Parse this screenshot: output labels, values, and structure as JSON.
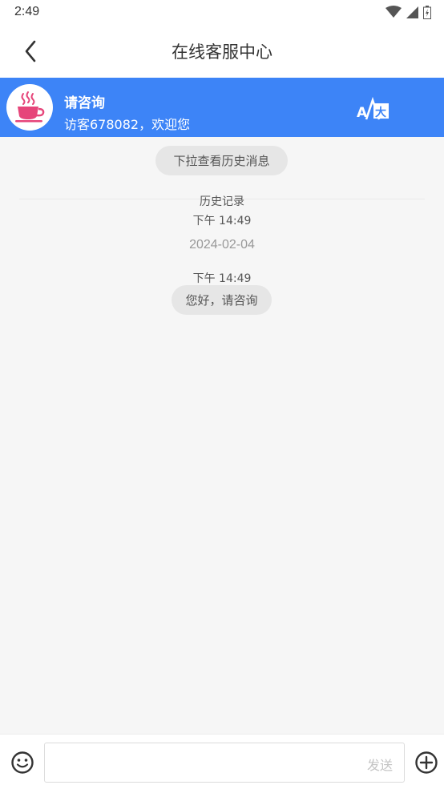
{
  "status_bar": {
    "time": "2:49"
  },
  "header": {
    "title": "在线客服中心"
  },
  "agent": {
    "name": "请咨询",
    "greeting": "访客678082，欢迎您"
  },
  "chat": {
    "history_button": "下拉查看历史消息",
    "history_label": "历史记录",
    "time_1": "下午 14:49",
    "date": "2024-02-04",
    "time_2": "下午 14:49",
    "message": "您好，请咨询"
  },
  "input": {
    "send_label": "发送",
    "value": ""
  },
  "colors": {
    "accent": "#3d84f7",
    "avatar_cup": "#e6457a"
  },
  "icons": [
    "back-icon",
    "coffee-cup-icon",
    "translate-icon",
    "emoji-icon",
    "plus-circle-icon",
    "wifi-icon",
    "signal-icon",
    "battery-icon"
  ]
}
